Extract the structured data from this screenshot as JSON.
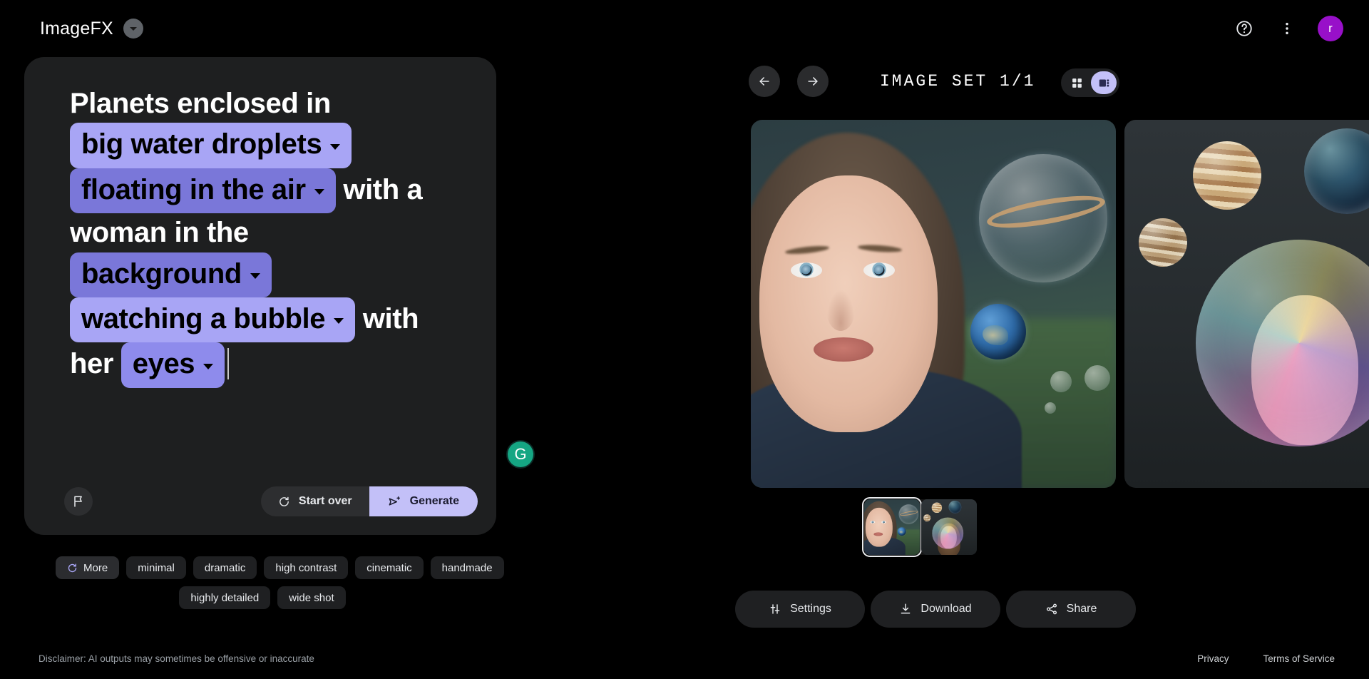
{
  "header": {
    "brand_title": "ImageFX",
    "brand_caret_icon": "chevron-down-icon",
    "help_icon": "help-circle-icon",
    "menu_icon": "more-vertical-icon",
    "avatar_initial": "r",
    "avatar_color": "#9810c9"
  },
  "prompt": {
    "segments": [
      {
        "type": "text",
        "value": "Planets enclosed in"
      },
      {
        "type": "chip",
        "value": "big water droplets",
        "style": "light"
      },
      {
        "type": "chip",
        "value": "floating in the air",
        "style": "dark"
      },
      {
        "type": "text",
        "value": "with a woman in the"
      },
      {
        "type": "chip",
        "value": "background",
        "style": "dark"
      },
      {
        "type": "chip",
        "value": "watching a bubble",
        "style": "light"
      },
      {
        "type": "text",
        "value": "with her"
      },
      {
        "type": "chip",
        "value": "eyes",
        "style": "mid"
      }
    ],
    "chip_caret_icon": "chevron-down-icon",
    "flag_icon": "flag-icon",
    "start_over_label": "Start over",
    "start_over_icon": "refresh-icon",
    "generate_label": "Generate",
    "generate_icon": "send-icon",
    "generate_bg": "#c3c0f8"
  },
  "suggestions": {
    "more_label": "More",
    "more_icon": "refresh-icon",
    "row1": [
      "minimal",
      "dramatic",
      "high contrast",
      "cinematic",
      "handmade"
    ],
    "row2": [
      "highly detailed",
      "wide shot"
    ]
  },
  "grammarly": {
    "label": "G",
    "color": "#15a683"
  },
  "image_set": {
    "title": "IMAGE SET 1/1",
    "prev_icon": "arrow-left-icon",
    "next_icon": "arrow-right-icon",
    "view_grid_icon": "grid-view-icon",
    "view_carousel_icon": "carousel-view-icon",
    "active_view": "carousel"
  },
  "gallery": {
    "images": [
      {
        "alt": "Woman looking up at planets inside water droplets",
        "selected": true
      },
      {
        "alt": "Planets in bubbles with woman inside a large soap bubble",
        "selected": false
      }
    ]
  },
  "actions": {
    "settings_label": "Settings",
    "settings_icon": "sliders-icon",
    "download_label": "Download",
    "download_icon": "download-icon",
    "share_label": "Share",
    "share_icon": "share-icon"
  },
  "footer": {
    "disclaimer": "Disclaimer: AI outputs may sometimes be offensive or inaccurate",
    "privacy": "Privacy",
    "terms": "Terms of Service"
  }
}
